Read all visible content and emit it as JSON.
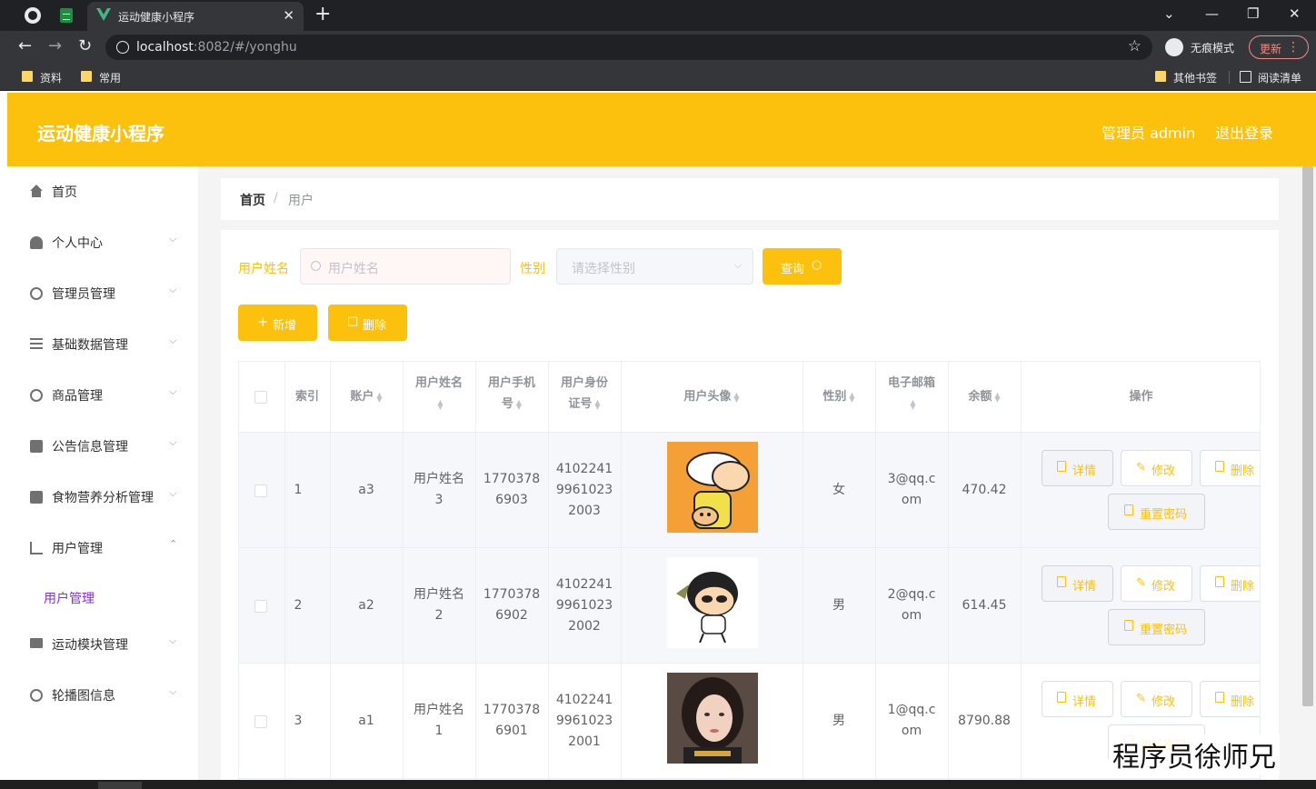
{
  "browser": {
    "tab_title": "运动健康小程序",
    "url_host": "localhost",
    "url_rest": ":8082/#/yonghu",
    "incognito_label": "无痕模式",
    "update_label": "更新",
    "bookmarks": [
      "资料",
      "常用"
    ],
    "bookmarks_right": [
      "其他书签",
      "阅读清单"
    ]
  },
  "header": {
    "brand": "运动健康小程序",
    "user": "管理员 admin",
    "logout": "退出登录",
    "color": "#fcc10d"
  },
  "sidebar": {
    "items": [
      {
        "label": "首页",
        "icon": "home-icon"
      },
      {
        "label": "个人中心",
        "icon": "person-icon"
      },
      {
        "label": "管理员管理",
        "icon": "circle-icon"
      },
      {
        "label": "基础数据管理",
        "icon": "list-icon"
      },
      {
        "label": "商品管理",
        "icon": "compass-icon"
      },
      {
        "label": "公告信息管理",
        "icon": "clipboard-icon"
      },
      {
        "label": "食物营养分析管理",
        "icon": "cup-icon"
      },
      {
        "label": "用户管理",
        "icon": "chart-icon"
      },
      {
        "label": "运动模块管理",
        "icon": "monitor-icon"
      },
      {
        "label": "轮播图信息",
        "icon": "clock-icon"
      }
    ],
    "sub_item": "用户管理",
    "sub_color": "#8a2be2"
  },
  "breadcrumb": {
    "home": "首页",
    "sep": "/",
    "current": "用户"
  },
  "search": {
    "name_label": "用户姓名",
    "name_placeholder": "用户姓名",
    "gender_label": "性别",
    "gender_placeholder": "请选择性别",
    "query_label": "查询"
  },
  "actions": {
    "add_label": "新增",
    "delete_label": "删除"
  },
  "table": {
    "headers": {
      "index": "索引",
      "account": "账户",
      "name_1": "用户姓名",
      "phone_1": "用户手机",
      "phone_2": "号",
      "idcard_1": "用户身份",
      "idcard_2": "证号",
      "avatar": "用户头像",
      "gender": "性别",
      "email": "电子邮箱",
      "balance": "余额",
      "ops": "操作"
    },
    "rows": [
      {
        "index": "1",
        "account": "a3",
        "name_1": "用户姓名",
        "name_2": "3",
        "phone_1": "1770378",
        "phone_2": "6903",
        "id_1": "4102241",
        "id_2": "9961023",
        "id_3": "2003",
        "gender": "女",
        "email_1": "3@qq.c",
        "email_2": "om",
        "balance": "470.42"
      },
      {
        "index": "2",
        "account": "a2",
        "name_1": "用户姓名",
        "name_2": "2",
        "phone_1": "1770378",
        "phone_2": "6902",
        "id_1": "4102241",
        "id_2": "9961023",
        "id_3": "2002",
        "gender": "男",
        "email_1": "2@qq.c",
        "email_2": "om",
        "balance": "614.45"
      },
      {
        "index": "3",
        "account": "a1",
        "name_1": "用户姓名",
        "name_2": "1",
        "phone_1": "1770378",
        "phone_2": "6901",
        "id_1": "4102241",
        "id_2": "9961023",
        "id_3": "2001",
        "gender": "男",
        "email_1": "1@qq.c",
        "email_2": "om",
        "balance": "8790.88"
      }
    ],
    "op_labels": {
      "detail": "详情",
      "edit": "修改",
      "delete": "删除",
      "reset": "重置密码"
    }
  },
  "watermark": "程序员徐师兄"
}
